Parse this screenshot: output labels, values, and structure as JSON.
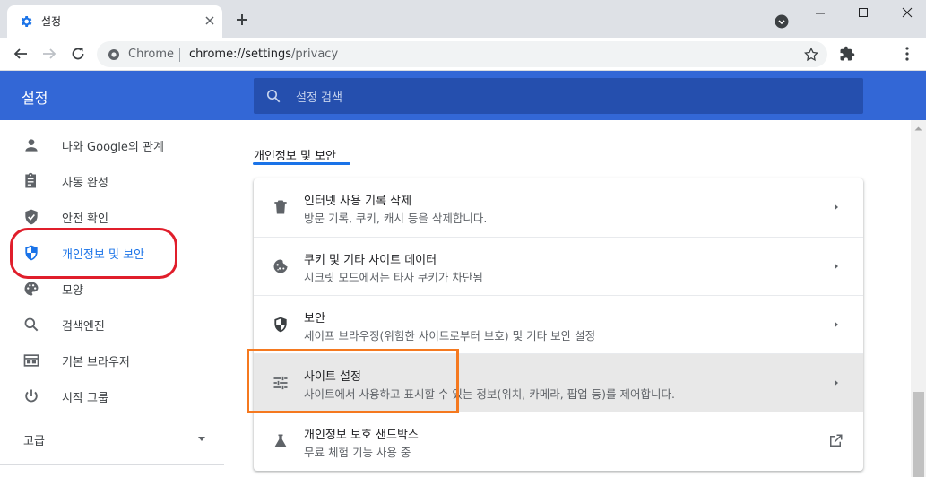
{
  "tab": {
    "title": "설정",
    "favicon": "gear-icon"
  },
  "window_controls": {
    "minimize": "minimize-icon",
    "maximize": "maximize-icon",
    "close": "close-icon"
  },
  "omnibox": {
    "chip": "Chrome",
    "url_host": "chrome://settings",
    "url_path": "/privacy"
  },
  "header": {
    "title": "설정",
    "search_placeholder": "설정 검색"
  },
  "sidebar": {
    "items": [
      {
        "label": "나와 Google의 관계",
        "icon": "person-icon"
      },
      {
        "label": "자동 완성",
        "icon": "clipboard-icon"
      },
      {
        "label": "안전 확인",
        "icon": "shield-check-icon"
      },
      {
        "label": "개인정보 및 보안",
        "icon": "shield-icon",
        "active": true
      },
      {
        "label": "모양",
        "icon": "palette-icon"
      },
      {
        "label": "검색엔진",
        "icon": "search-icon"
      },
      {
        "label": "기본 브라우저",
        "icon": "browser-icon"
      },
      {
        "label": "시작 그룹",
        "icon": "power-icon"
      }
    ],
    "advanced": "고급"
  },
  "main": {
    "section_title": "개인정보 및 보안",
    "rows": [
      {
        "title": "인터넷 사용 기록 삭제",
        "subtitle": "방문 기록, 쿠키, 캐시 등을 삭제합니다.",
        "icon": "trash-icon"
      },
      {
        "title": "쿠키 및 기타 사이트 데이터",
        "subtitle": "시크릿 모드에서는 타사 쿠키가 차단됨",
        "icon": "cookie-icon"
      },
      {
        "title": "보안",
        "subtitle": "세이프 브라우징(위험한 사이트로부터 보호) 및 기타 보안 설정",
        "icon": "shield-icon"
      },
      {
        "title": "사이트 설정",
        "subtitle": "사이트에서 사용하고 표시할 수 있는 정보(위치, 카메라, 팝업 등)를 제어합니다.",
        "icon": "tune-icon",
        "highlighted": true
      },
      {
        "title": "개인정보 보호 샌드박스",
        "subtitle": "무료 체험 기능 사용 중",
        "icon": "flask-icon"
      }
    ]
  },
  "colors": {
    "header": "#3367d6",
    "search": "#254fae",
    "accent": "#1a73e8",
    "annotation_red": "#e01e2b",
    "annotation_orange": "#f5791f"
  }
}
